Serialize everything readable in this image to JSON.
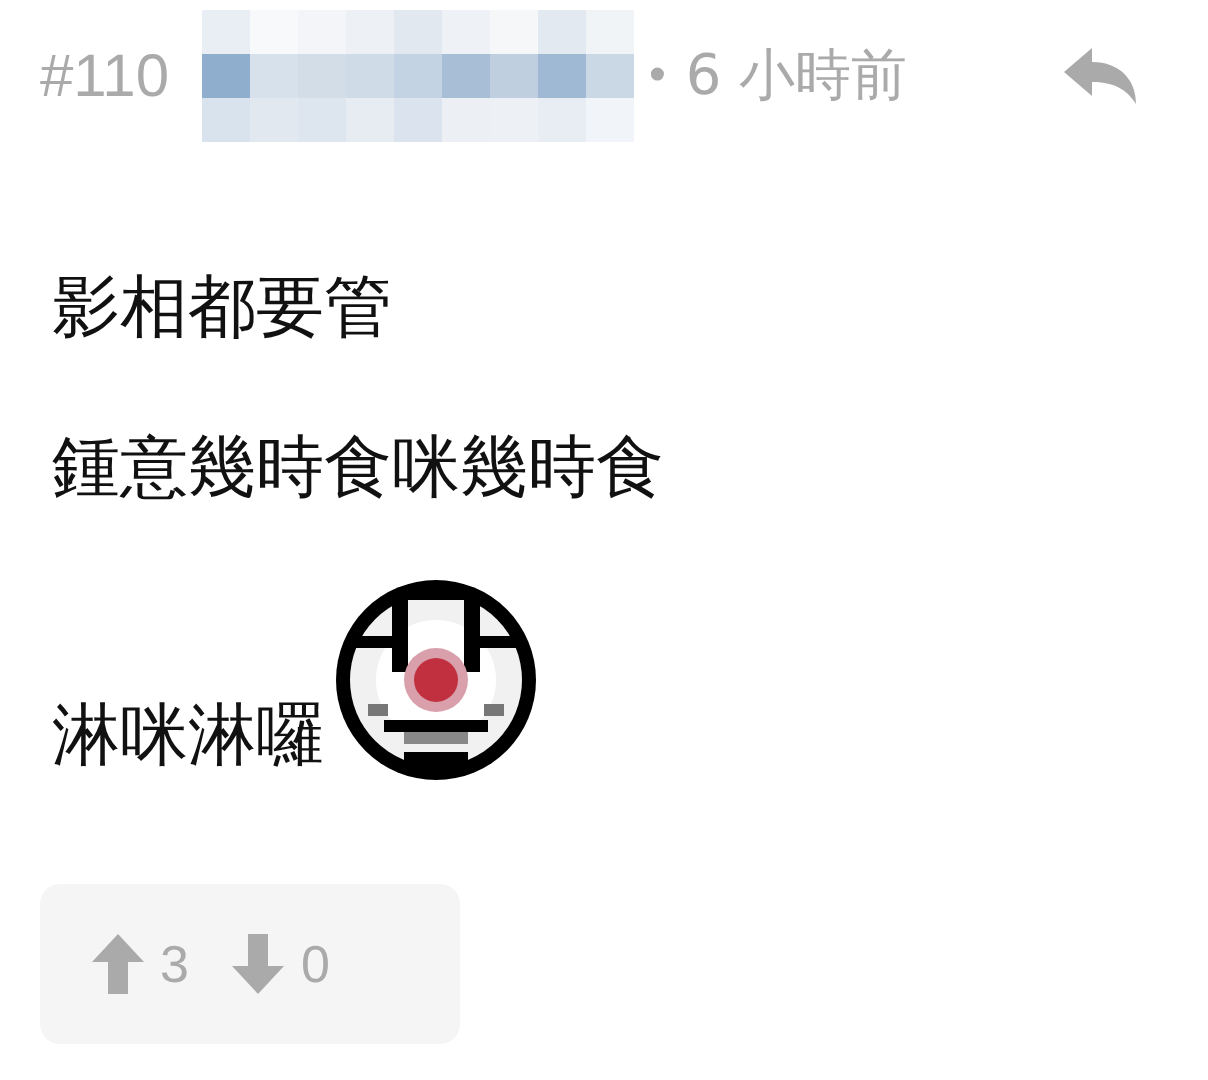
{
  "post": {
    "number": "#110",
    "separator": "•",
    "time": "6 小時前"
  },
  "lines": [
    {
      "kind": "text",
      "text": "影相都要管"
    },
    {
      "kind": "text",
      "text": "鍾意幾時食咪幾時食"
    },
    {
      "kind": "text_sticker",
      "text": "淋咪淋囉"
    }
  ],
  "votes": {
    "up": "3",
    "down": "0"
  }
}
